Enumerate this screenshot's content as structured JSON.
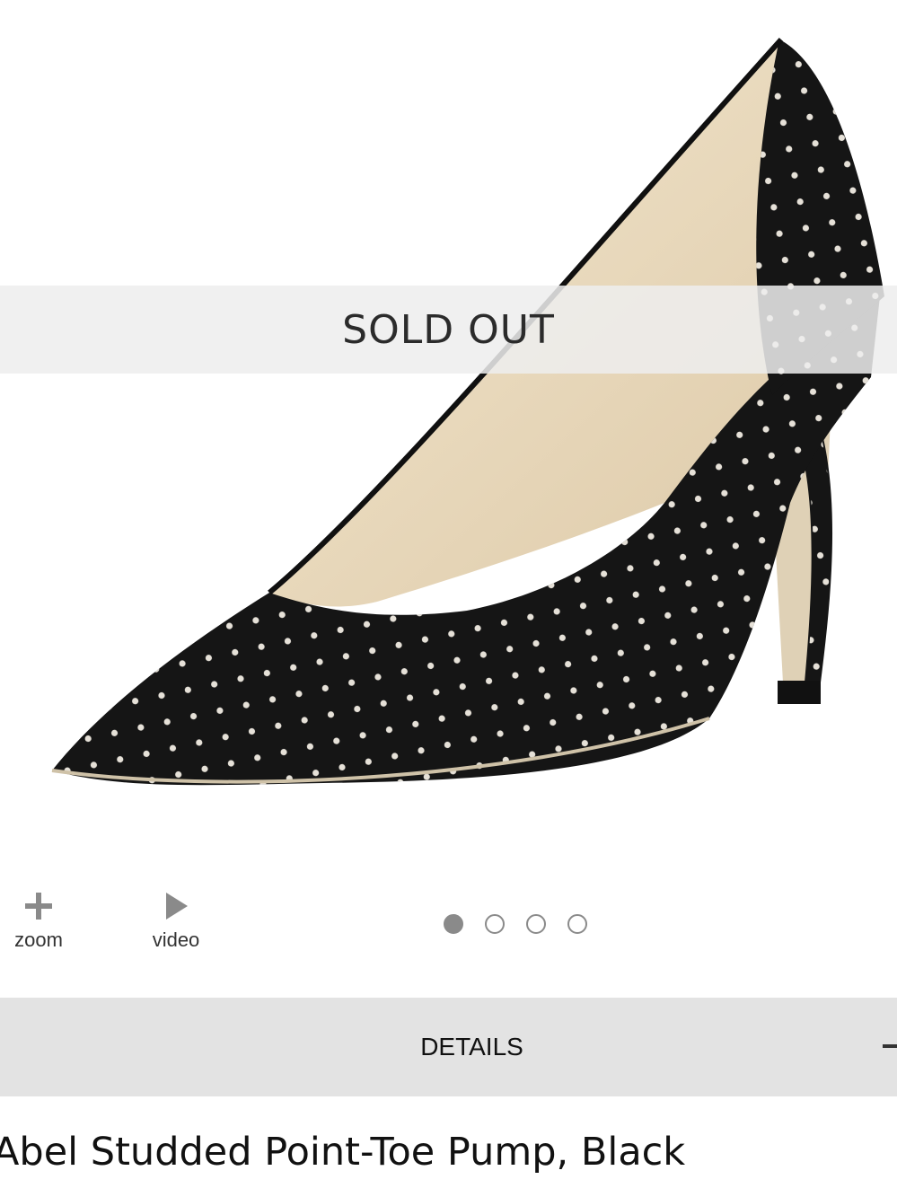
{
  "product": {
    "title": "Abel Studded Point-Toe Pump, Black",
    "image_alt": "black studded pointed-toe pump",
    "status_banner": "SOLD OUT"
  },
  "media_controls": {
    "zoom": {
      "label": "zoom",
      "icon": "plus-icon"
    },
    "video": {
      "label": "video",
      "icon": "play-icon"
    }
  },
  "carousel": {
    "count": 4,
    "active_index": 0
  },
  "details_section": {
    "label": "DETAILS",
    "toggle_icon": "minus-icon"
  },
  "colors": {
    "banner_bg": "#eeeeee",
    "details_bg": "#e3e3e3",
    "control_gray": "#8a8a8a",
    "suede_black": "#151515",
    "lining_beige": "#ecdcc0"
  }
}
